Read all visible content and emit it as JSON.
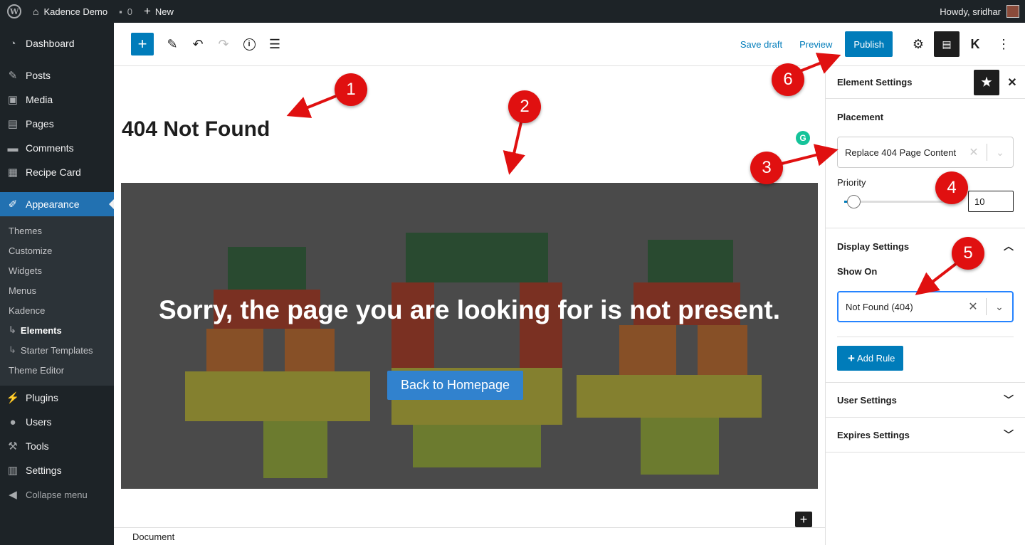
{
  "adminbar": {
    "site_name": "Kadence Demo",
    "comments_count": "0",
    "new_label": "New",
    "greeting": "Howdy, sridhar"
  },
  "sidebar": {
    "items": [
      {
        "label": "Dashboard",
        "icon": "dashboard-icon"
      },
      {
        "label": "Posts",
        "icon": "pin-icon"
      },
      {
        "label": "Media",
        "icon": "media-icon"
      },
      {
        "label": "Pages",
        "icon": "pages-icon"
      },
      {
        "label": "Comments",
        "icon": "comment-icon"
      },
      {
        "label": "Recipe Card",
        "icon": "recipe-icon"
      },
      {
        "label": "Appearance",
        "icon": "brush-icon"
      },
      {
        "label": "Plugins",
        "icon": "plug-icon"
      },
      {
        "label": "Users",
        "icon": "users-icon"
      },
      {
        "label": "Tools",
        "icon": "wrench-icon"
      },
      {
        "label": "Settings",
        "icon": "sliders-icon"
      }
    ],
    "submenu": [
      "Themes",
      "Customize",
      "Widgets",
      "Menus",
      "Kadence",
      "Elements",
      "Starter Templates",
      "Theme Editor"
    ],
    "collapse_label": "Collapse menu"
  },
  "header": {
    "save_draft": "Save draft",
    "preview": "Preview",
    "publish": "Publish"
  },
  "canvas": {
    "title": "404 Not Found",
    "hero_heading": "Sorry, the page you are looking for is not present.",
    "hero_button": "Back to Homepage",
    "grammarly": "G"
  },
  "footer": {
    "breadcrumb": "Document"
  },
  "panel": {
    "title": "Element Settings",
    "placement_label": "Placement",
    "placement_value": "Replace 404 Page Content",
    "priority_label": "Priority",
    "priority_value": "10",
    "display_settings": "Display Settings",
    "show_on_label": "Show On",
    "show_on_value": "Not Found (404)",
    "add_rule": "Add Rule",
    "user_settings": "User Settings",
    "expires_settings": "Expires Settings"
  },
  "annotations": [
    "1",
    "2",
    "3",
    "4",
    "5",
    "6"
  ],
  "colors": {
    "admin_dark": "#1d2327",
    "accent_blue": "#007cba",
    "annotation_red": "#e01010"
  }
}
